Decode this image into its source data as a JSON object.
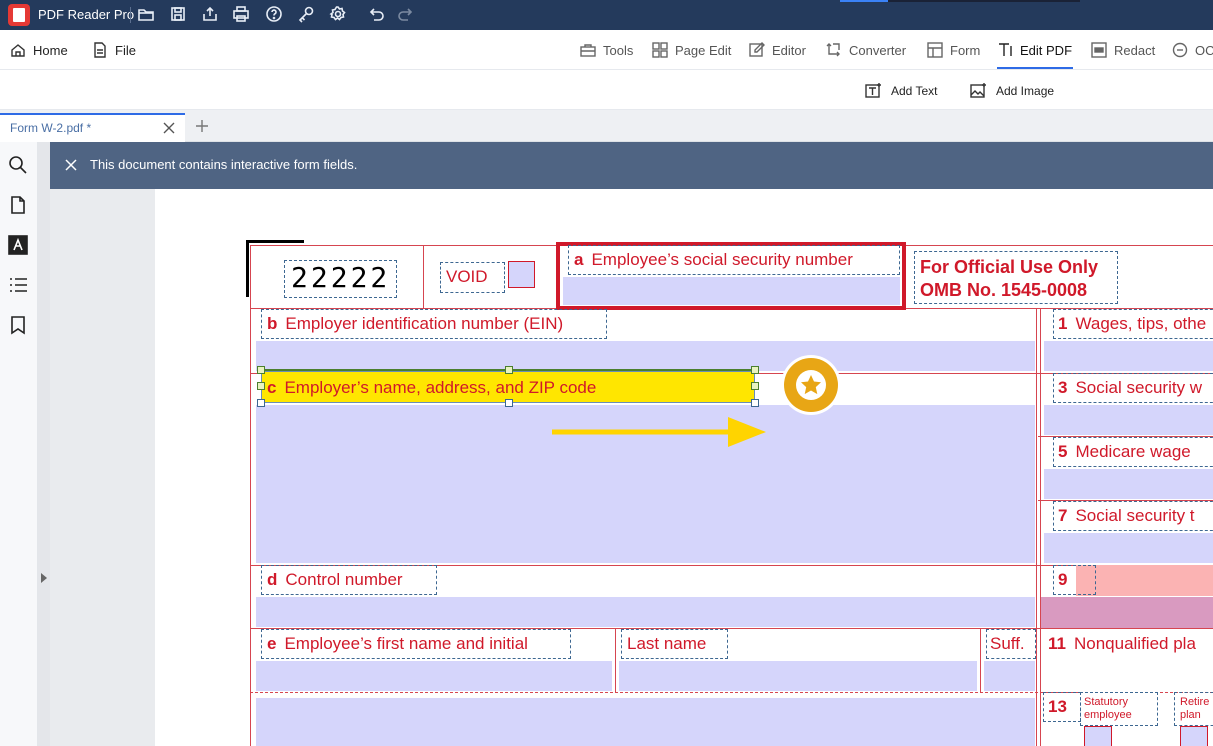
{
  "app": {
    "name": "PDF Reader Pro",
    "colors": {
      "titlebar": "#243a5c",
      "accent_blue": "#2e6be6",
      "form_red": "#d0192a",
      "field_fill": "#d5d5fb",
      "highlight_yellow": "#ffe600"
    }
  },
  "titlebar_icons": [
    "open-folder-icon",
    "save-icon",
    "share-icon",
    "print-icon",
    "help-icon",
    "key-icon",
    "settings-icon",
    "undo-icon",
    "redo-icon"
  ],
  "menu": {
    "home": "Home",
    "file": "File",
    "tools": "Tools",
    "page_edit": "Page Edit",
    "editor": "Editor",
    "converter": "Converter",
    "form": "Form",
    "edit_pdf": "Edit PDF",
    "redact": "Redact",
    "ocr": "OC"
  },
  "subtoolbar": {
    "add_text": "Add Text",
    "add_image": "Add Image"
  },
  "tabs": {
    "doc_tab": "Form W-2.pdf *"
  },
  "notice": {
    "text": "This document contains interactive form fields."
  },
  "form": {
    "code": "22222",
    "void": "VOID",
    "a_letter": "a",
    "a_label": "Employee’s social security number",
    "official_line1": "For Official Use Only",
    "official_line2": "OMB No. 1545-0008",
    "b_letter": "b",
    "b_label": "Employer identification number (EIN)",
    "c_letter": "c",
    "c_label": "Employer’s name, address, and ZIP code",
    "d_letter": "d",
    "d_label": "Control number",
    "e_letter": "e",
    "e_label": "Employee’s first name and initial",
    "last_name": "Last name",
    "suff": "Suff.",
    "box1_num": "1",
    "box1_label": "Wages, tips, othe",
    "box3_num": "3",
    "box3_label": "Social security w",
    "box5_num": "5",
    "box5_label": "Medicare wage",
    "box7_num": "7",
    "box7_label": "Social security t",
    "box9_num": "9",
    "box11_num": "11",
    "box11_label": "Nonqualified pla",
    "box13_num": "13",
    "statutory_line1": "Statutory",
    "statutory_line2": "employee",
    "retire_line1": "Retire",
    "retire_line2": "plan"
  }
}
